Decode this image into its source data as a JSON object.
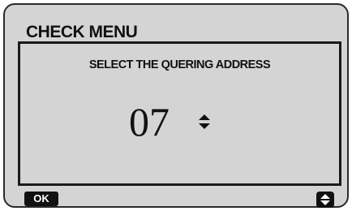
{
  "header": {
    "title": "CHECK MENU"
  },
  "panel": {
    "prompt": "SELECT THE QUERING ADDRESS",
    "address_value": "07",
    "adjust_icon": "up-down-arrows-icon"
  },
  "footer": {
    "ok_label": "OK",
    "scroll_icon": "up-down-arrows-icon"
  },
  "colors": {
    "screen_background": "#d4d4d4",
    "foreground": "#111111"
  }
}
